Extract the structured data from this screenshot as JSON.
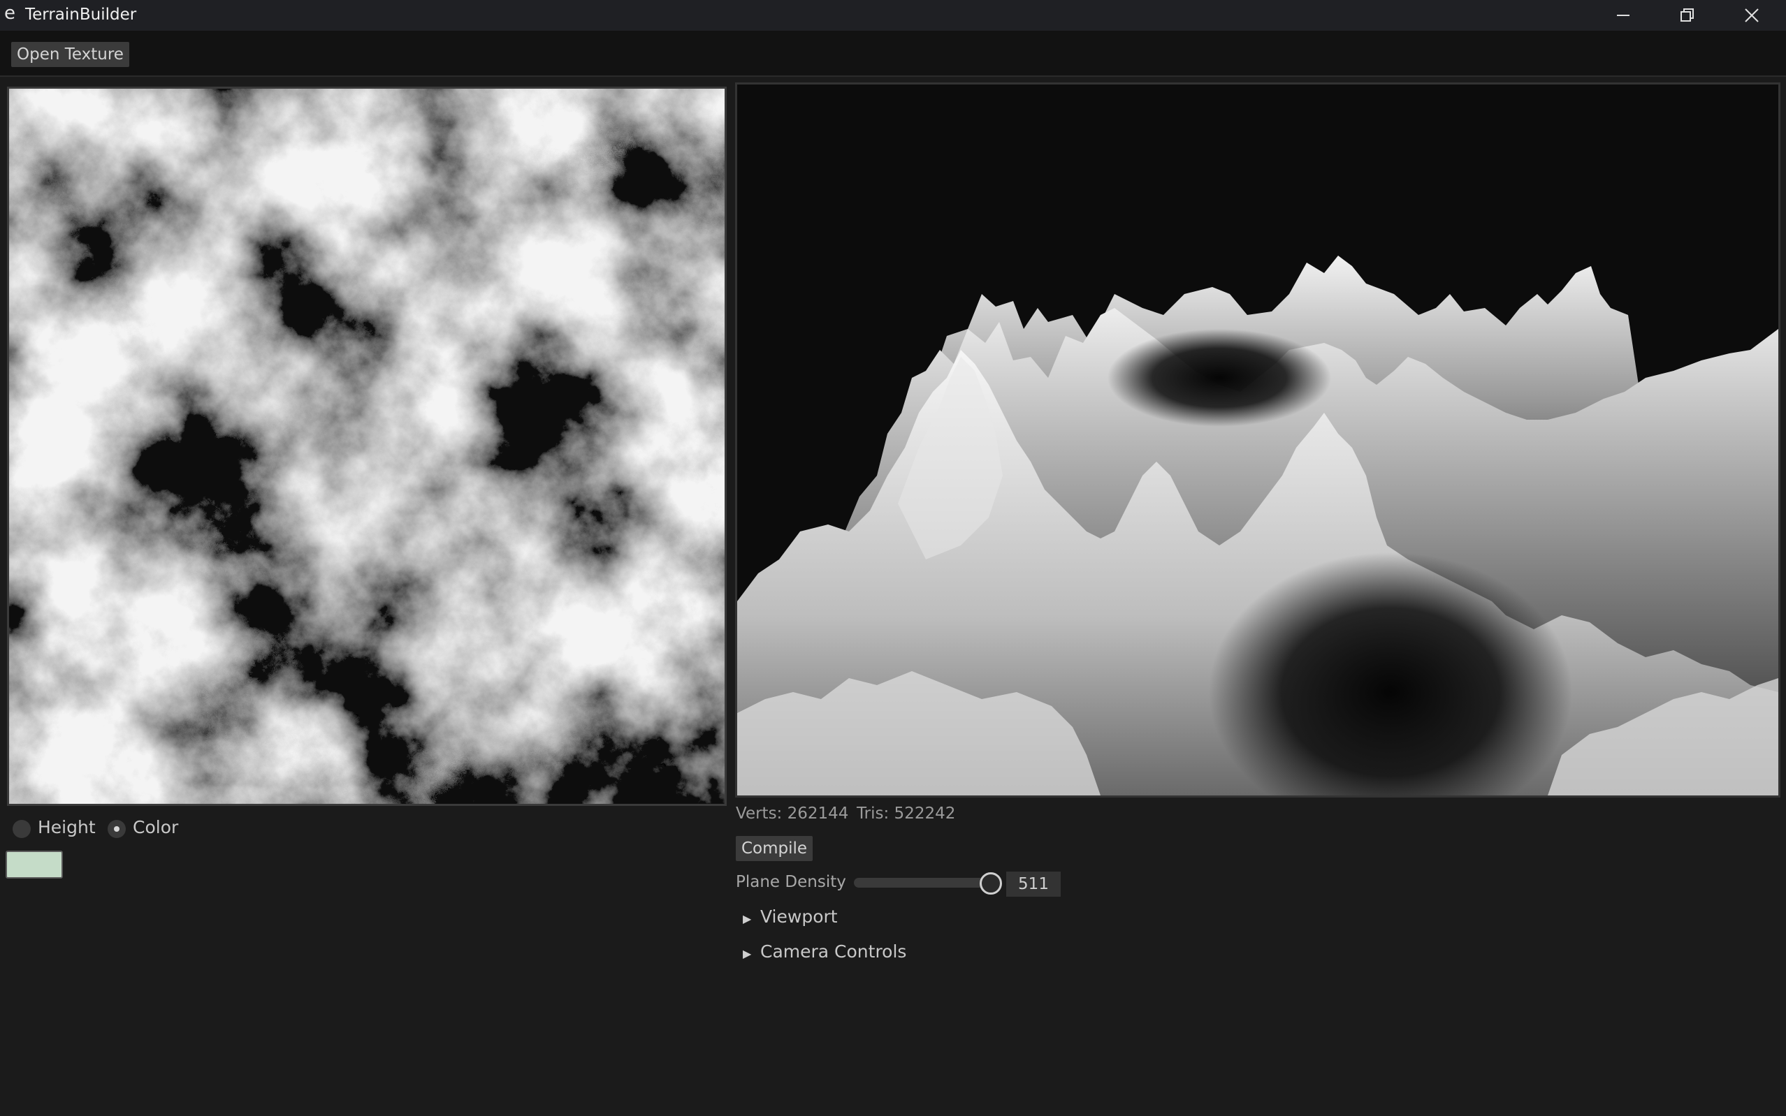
{
  "window": {
    "icon_glyph": "e",
    "title": "TerrainBuilder",
    "controls": [
      "minimize-icon",
      "restore-icon",
      "close-icon"
    ]
  },
  "toolbar": {
    "open_texture_label": "Open Texture"
  },
  "texture_panel": {
    "image": "grayscale cloud noise heightmap"
  },
  "viewport_panel": {
    "image": "3D rendered grayscale terrain mesh"
  },
  "mode": {
    "options": [
      "Height",
      "Color"
    ],
    "selected": "Color"
  },
  "color_swatch": {
    "color": "#c5dcc8"
  },
  "stats": {
    "verts_label": "Verts: 262144",
    "tris_label": "Tris: 522242"
  },
  "compile_label": "Compile",
  "plane_density": {
    "label": "Plane Density",
    "value": "511",
    "fraction": 0.97
  },
  "sections": [
    {
      "label": "Viewport",
      "expanded": false
    },
    {
      "label": "Camera Controls",
      "expanded": false
    }
  ],
  "colors": {
    "background": "#1b1b1b",
    "titlebar": "#1f2024",
    "toolbar": "#121212",
    "button": "#3b3b3b"
  }
}
